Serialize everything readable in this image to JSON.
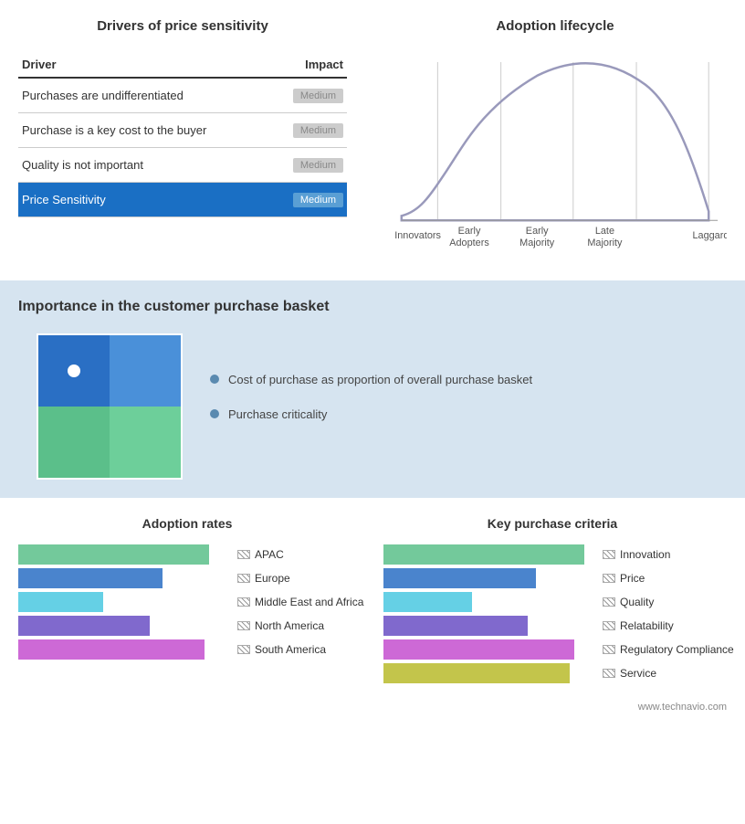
{
  "topLeft": {
    "title": "Drivers of price sensitivity",
    "table": {
      "col1": "Driver",
      "col2": "Impact",
      "rows": [
        {
          "driver": "Purchases are undifferentiated",
          "impact": "Medium"
        },
        {
          "driver": "Purchase is a key cost to the buyer",
          "impact": "Medium"
        },
        {
          "driver": "Quality is not important",
          "impact": "Medium"
        }
      ],
      "highlight": {
        "label": "Price Sensitivity",
        "impact": "Medium"
      }
    }
  },
  "topRight": {
    "title": "Adoption lifecycle",
    "labels": [
      "Innovators",
      "Early\nAdopters",
      "Early\nMajority",
      "Late\nMajority",
      "Laggards"
    ]
  },
  "middle": {
    "title": "Importance in the customer purchase basket",
    "legend": [
      {
        "text": "Cost of purchase as proportion of overall purchase basket"
      },
      {
        "text": "Purchase criticality"
      }
    ]
  },
  "bottomLeft": {
    "title": "Adoption rates",
    "bars": [
      {
        "label": "APAC",
        "width": 90,
        "color": "#5bbf8a"
      },
      {
        "label": "Europe",
        "width": 68,
        "color": "#2a6fc4"
      },
      {
        "label": "Middle East and Africa",
        "width": 40,
        "color": "#4ac8e0"
      },
      {
        "label": "North America",
        "width": 62,
        "color": "#6a4fc4"
      },
      {
        "label": "South America",
        "width": 88,
        "color": "#c44fcf"
      }
    ]
  },
  "bottomRight": {
    "title": "Key purchase criteria",
    "bars": [
      {
        "label": "Innovation",
        "width": 95,
        "color": "#5bbf8a"
      },
      {
        "label": "Price",
        "width": 72,
        "color": "#2a6fc4"
      },
      {
        "label": "Quality",
        "width": 42,
        "color": "#4ac8e0"
      },
      {
        "label": "Relatability",
        "width": 68,
        "color": "#6a4fc4"
      },
      {
        "label": "Regulatory Compliance",
        "width": 90,
        "color": "#c44fcf"
      },
      {
        "label": "Service",
        "width": 88,
        "color": "#b8bb2c"
      }
    ]
  },
  "footer": "www.technavio.com"
}
